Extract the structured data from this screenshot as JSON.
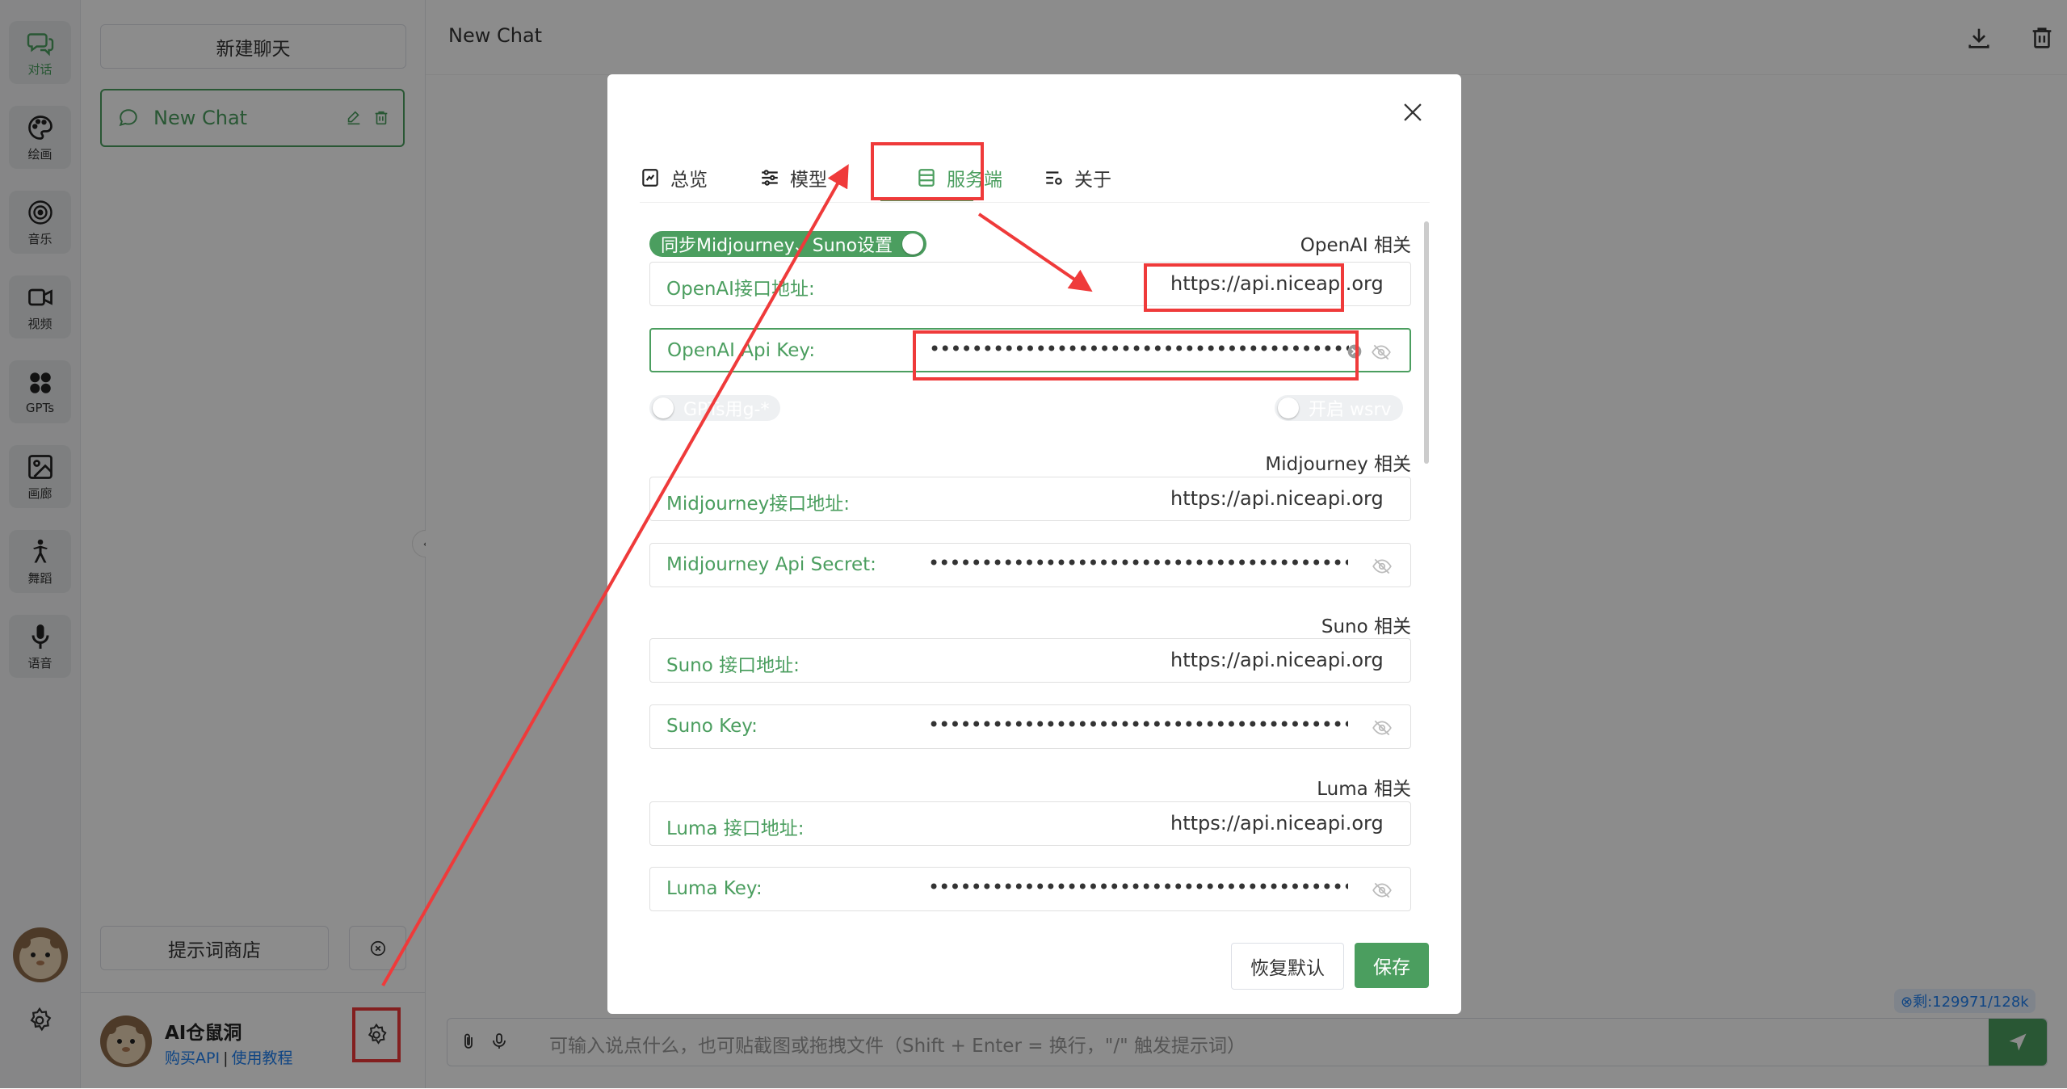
{
  "rail": {
    "items": [
      {
        "label": "对话",
        "icon": "chat-icon"
      },
      {
        "label": "绘画",
        "icon": "palette-icon"
      },
      {
        "label": "音乐",
        "icon": "music-icon"
      },
      {
        "label": "视频",
        "icon": "video-icon"
      },
      {
        "label": "GPTs",
        "icon": "apps-icon"
      },
      {
        "label": "画廊",
        "icon": "gallery-icon"
      },
      {
        "label": "舞蹈",
        "icon": "dance-icon"
      },
      {
        "label": "语音",
        "icon": "mic-icon"
      }
    ]
  },
  "sidebar": {
    "new_chat_button": "新建聊天",
    "chat_item": "New Chat",
    "prompt_store_button": "提示词商店",
    "user": {
      "name": "AI仓鼠洞",
      "buy_api": "购买API",
      "separator": "|",
      "tutorial": "使用教程"
    }
  },
  "main": {
    "title": "New Chat",
    "input_placeholder": "可输入说点什么，也可贴截图或拖拽文件（Shift + Enter = 换行，\"/\" 触发提示词）",
    "quota": "⊗剩:129971/128k"
  },
  "modal": {
    "tabs": [
      {
        "label": "总览",
        "icon": "document-icon"
      },
      {
        "label": "模型",
        "icon": "sliders-icon"
      },
      {
        "label": "服务端",
        "icon": "server-icon",
        "active": true
      },
      {
        "label": "关于",
        "icon": "about-icon"
      }
    ],
    "sync_toggle": "同步Midjourney、Suno设置",
    "sections": {
      "openai": "OpenAI 相关",
      "midjourney": "Midjourney 相关",
      "suno": "Suno 相关",
      "luma": "Luma 相关"
    },
    "fields": {
      "openai_url": {
        "label": "OpenAI接口地址:",
        "value": "https://api.niceapi.org"
      },
      "openai_key": {
        "label": "OpenAI Api Key:",
        "value": "•••••••••••••••••••••••••••••••••••••••••••••••••"
      },
      "mj_url": {
        "label": "Midjourney接口地址:",
        "value": "https://api.niceapi.org"
      },
      "mj_secret": {
        "label": "Midjourney Api Secret:",
        "value": "•••••••••••••••••••••••••••••••••••••••••••••••••"
      },
      "suno_url": {
        "label": "Suno 接口地址:",
        "value": "https://api.niceapi.org"
      },
      "suno_key": {
        "label": "Suno Key:",
        "value": "•••••••••••••••••••••••••••••••••••••••••••••••••"
      },
      "luma_url": {
        "label": "Luma 接口地址:",
        "value": "https://api.niceapi.org"
      },
      "luma_key": {
        "label": "Luma Key:",
        "value": "•••••••••••••••••••••••••••••••••••••••••••••••••"
      }
    },
    "gpt_toggle": "GPTs用g-*",
    "wsrv_toggle": "开启 wsrv",
    "reset_button": "恢复默认",
    "save_button": "保存"
  },
  "colors": {
    "accent": "#4b9e5f",
    "highlight": "#ef3a3a",
    "link": "#2080f0"
  }
}
